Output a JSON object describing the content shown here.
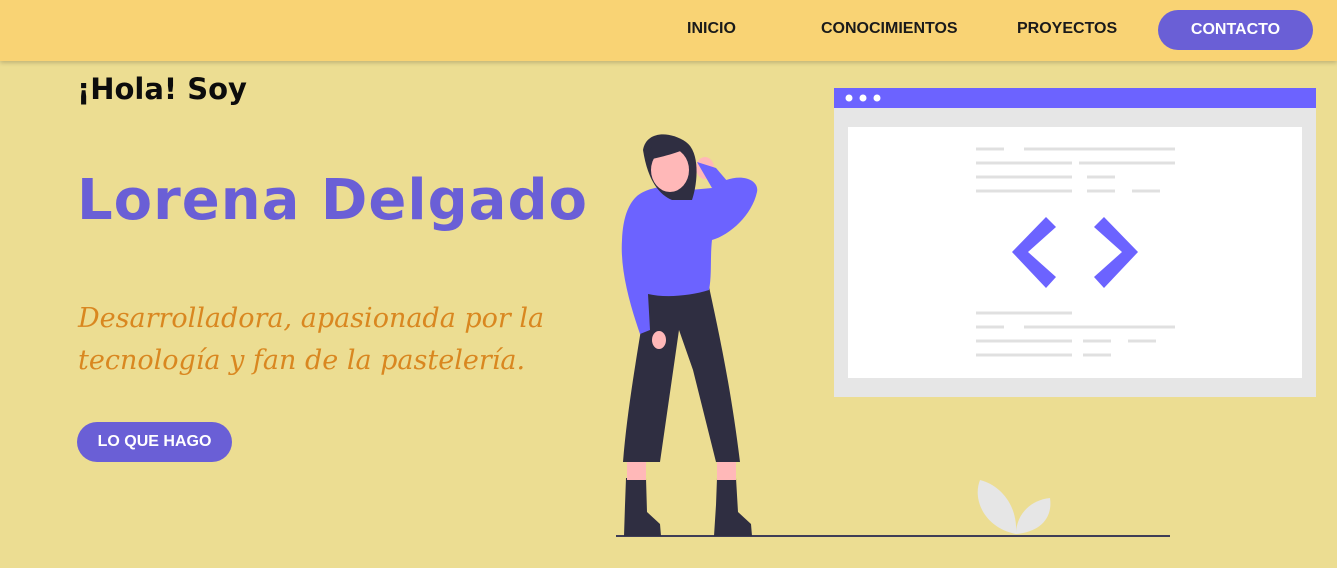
{
  "nav": {
    "items": [
      {
        "label": "INICIO"
      },
      {
        "label": "CONOCIMIENTOS"
      },
      {
        "label": "PROYECTOS"
      }
    ],
    "contact_label": "CONTACTO"
  },
  "hero": {
    "greeting": "¡Hola! Soy",
    "name": "Lorena Delgado",
    "tagline": "Desarrolladora, apasionada por la tecnología y fan de la pastelería.",
    "cta_label": "LO QUE HAGO"
  },
  "colors": {
    "background": "#ecdd92",
    "header": "#f9d374",
    "accent": "#6a5fd6",
    "tagline": "#d98720"
  },
  "illustration": {
    "icons": [
      "woman-figure-icon",
      "browser-window-icon",
      "code-brackets-icon",
      "leaf-plant-icon"
    ]
  }
}
